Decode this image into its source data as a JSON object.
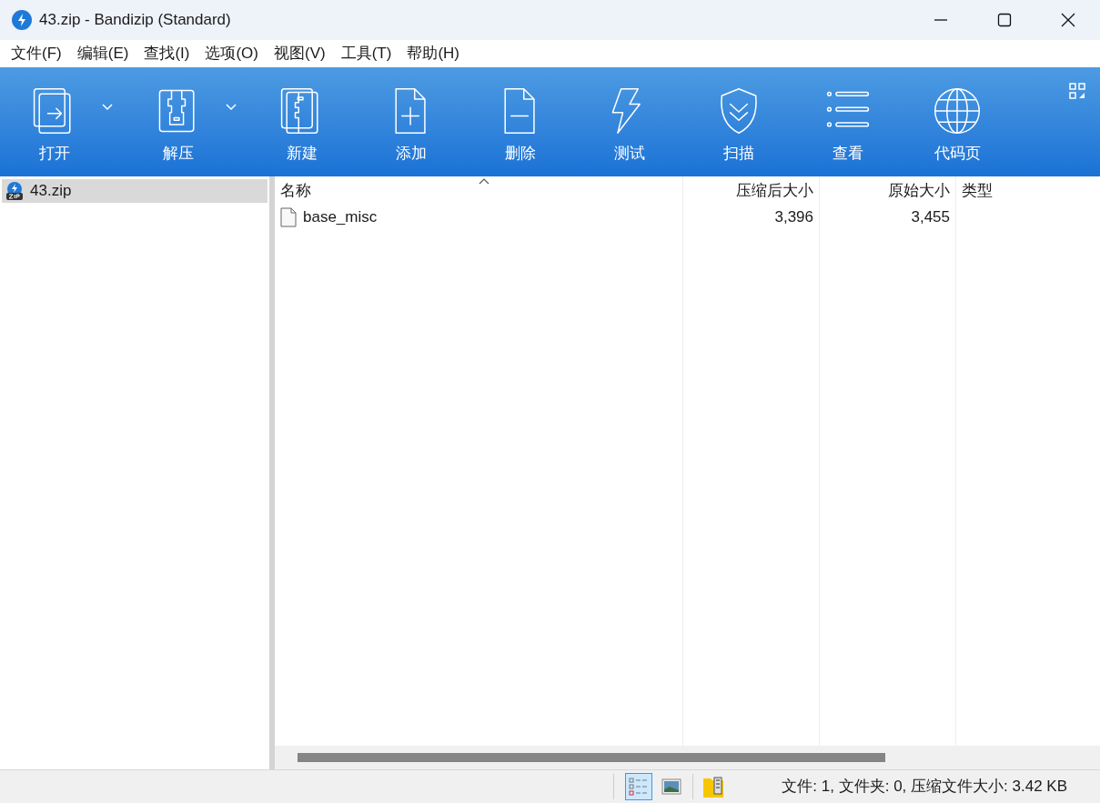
{
  "window": {
    "title": "43.zip - Bandizip (Standard)"
  },
  "menu": [
    "文件(F)",
    "编辑(E)",
    "查找(I)",
    "选项(O)",
    "视图(V)",
    "工具(T)",
    "帮助(H)"
  ],
  "toolbar": [
    {
      "label": "打开",
      "kind": "split"
    },
    {
      "label": "解压",
      "kind": "split"
    },
    {
      "label": "新建",
      "kind": "button"
    },
    {
      "label": "添加",
      "kind": "button"
    },
    {
      "label": "删除",
      "kind": "button"
    },
    {
      "label": "测试",
      "kind": "button"
    },
    {
      "label": "扫描",
      "kind": "button"
    },
    {
      "label": "查看",
      "kind": "button"
    },
    {
      "label": "代码页",
      "kind": "button"
    }
  ],
  "tree": [
    {
      "label": "43.zip",
      "selected": true
    }
  ],
  "table": {
    "columns": [
      {
        "label": "名称",
        "sorted": true
      },
      {
        "label": "压缩后大小",
        "sorted": false
      },
      {
        "label": "原始大小",
        "sorted": false
      },
      {
        "label": "类型",
        "sorted": false
      }
    ],
    "rows": [
      {
        "name": "base_misc",
        "compressed": "3,396",
        "original": "3,455"
      }
    ]
  },
  "status_bar": {
    "views": [
      {
        "selected": true
      },
      {
        "selected": false
      }
    ],
    "text": "文件: 1, 文件夹: 0, 压缩文件大小: 3.42 KB"
  }
}
